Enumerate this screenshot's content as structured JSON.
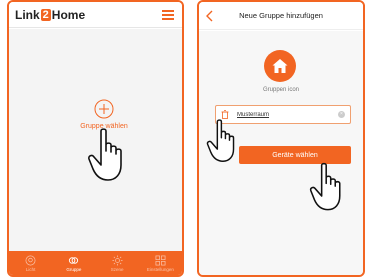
{
  "left_screen": {
    "header": {
      "logo_part1": "Link",
      "logo_part2": "2",
      "logo_part3": "Home",
      "menu_icon": "hamburger-menu-icon"
    },
    "add_group": {
      "icon": "plus-circle-icon",
      "label": "Gruppe wählen"
    },
    "tabbar": {
      "tabs": [
        {
          "label": "Licht",
          "icon": "bulb-circle-icon",
          "active": false
        },
        {
          "label": "Gruppe",
          "icon": "linked-rings-icon",
          "active": true
        },
        {
          "label": "Szene",
          "icon": "sun-icon",
          "active": false
        },
        {
          "label": "Einstellungen",
          "icon": "grid-icon",
          "active": false
        }
      ]
    }
  },
  "right_screen": {
    "header": {
      "back_icon": "chevron-left-icon",
      "title": "Neue Gruppe hinzufügen"
    },
    "group_icon": {
      "icon": "house-icon",
      "label": "Gruppen icon"
    },
    "name_field": {
      "icon": "trash-icon",
      "value": "Musterraum",
      "clear_icon": "clear-icon"
    },
    "primary_button": {
      "label": "Geräte wählen"
    }
  },
  "overlay": {
    "pointer_icon": "hand-pointer-icon"
  },
  "colors": {
    "accent": "#f26522",
    "background": "#f4f4f4",
    "header_background": "#ffffff"
  }
}
